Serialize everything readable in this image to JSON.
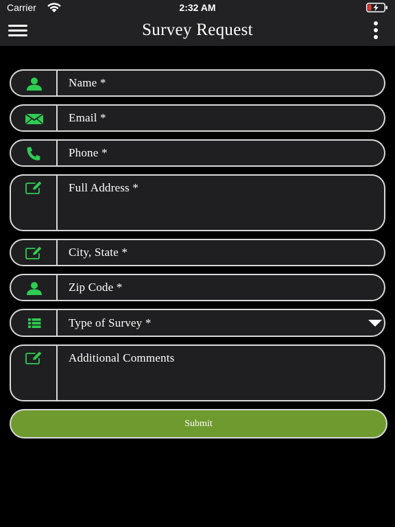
{
  "status_bar": {
    "carrier": "Carrier",
    "time": "2:32 AM"
  },
  "header": {
    "title": "Survey Request"
  },
  "form": {
    "name_placeholder": "Name *",
    "email_placeholder": "Email *",
    "phone_placeholder": "Phone *",
    "address_placeholder": "Full Address *",
    "city_state_placeholder": "City, State *",
    "zip_placeholder": "Zip Code *",
    "survey_type_placeholder": "Type of Survey *",
    "comments_placeholder": "Additional Comments",
    "submit_label": "Submit"
  },
  "colors": {
    "icon_accent": "#2ecc52",
    "submit_bg": "#6f9a2f",
    "field_bg": "#1f1f21",
    "field_border": "#d9d9d9",
    "battery_low": "#e53935"
  },
  "icons": {
    "status": [
      "wifi-icon",
      "battery-icon",
      "charging-bolt-icon"
    ],
    "header": [
      "hamburger-menu-icon",
      "more-vertical-icon"
    ],
    "fields": [
      "user-icon",
      "envelope-icon",
      "phone-icon",
      "edit-icon",
      "edit-icon",
      "user-icon",
      "list-icon",
      "edit-icon"
    ]
  }
}
